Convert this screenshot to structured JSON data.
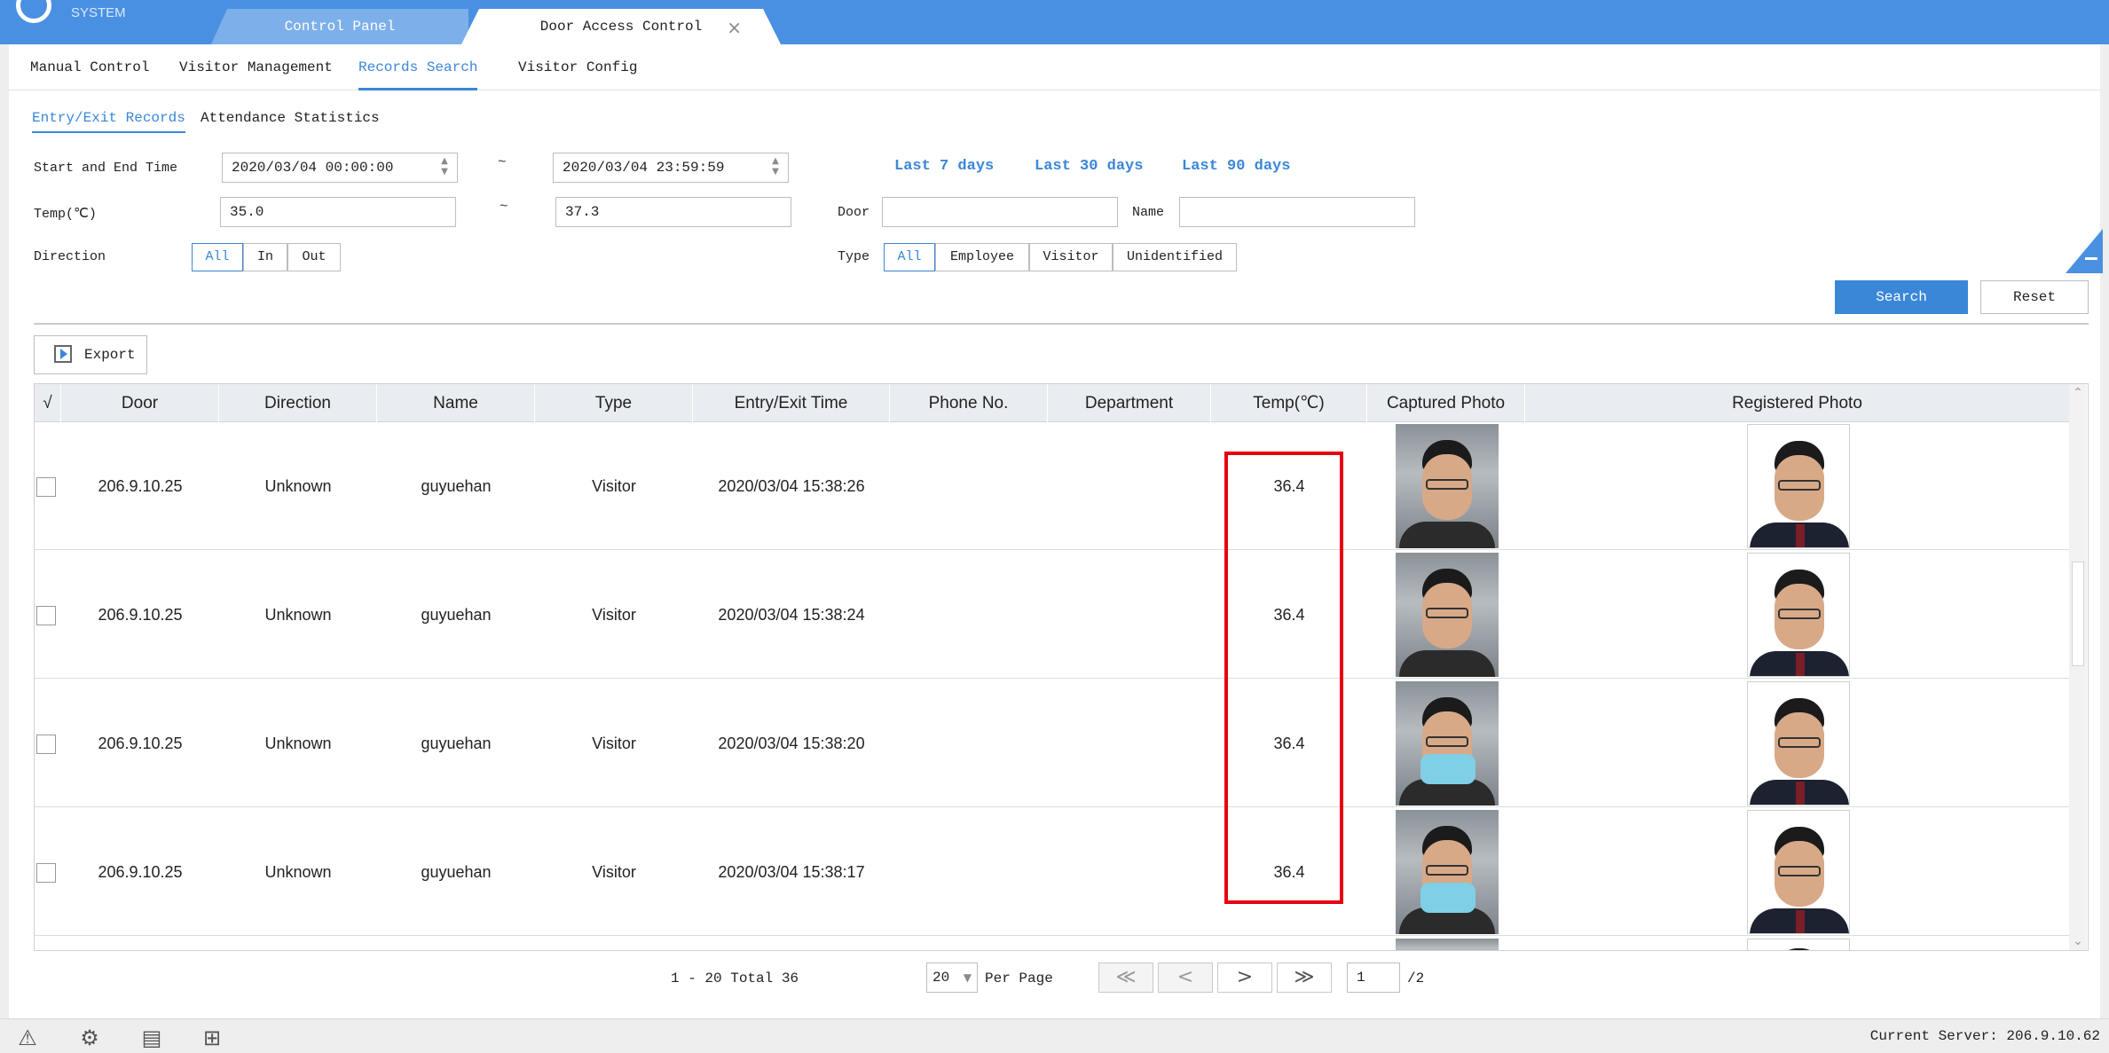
{
  "app": {
    "system_label": "SYSTEM"
  },
  "tabs": [
    {
      "label": "Control Panel",
      "active": false
    },
    {
      "label": "Door Access Control",
      "active": true,
      "close": "×"
    }
  ],
  "subnav": [
    "Manual Control",
    "Visitor Management",
    "Records Search",
    "Visitor Config"
  ],
  "subnav_active": "Records Search",
  "filter_tabs": [
    "Entry/Exit Records",
    "Attendance Statistics"
  ],
  "filters": {
    "time_label": "Start and End Time",
    "start_time": "2020/03/04 00:00:00",
    "end_time": "2020/03/04 23:59:59",
    "tilde": "~",
    "quick": [
      "Last 7 days",
      "Last 30 days",
      "Last 90 days"
    ],
    "temp_label": "Temp(℃)",
    "temp_min": "35.0",
    "temp_max": "37.3",
    "door_label": "Door",
    "door_value": "",
    "name_label": "Name",
    "name_value": "",
    "direction_label": "Direction",
    "direction_options": [
      "All",
      "In",
      "Out"
    ],
    "direction_selected": "All",
    "type_label": "Type",
    "type_options": [
      "All",
      "Employee",
      "Visitor",
      "Unidentified"
    ],
    "type_selected": "All",
    "search": "Search",
    "reset": "Reset"
  },
  "export_label": "Export",
  "table": {
    "check_header": "√",
    "columns": [
      "Door",
      "Direction",
      "Name",
      "Type",
      "Entry/Exit Time",
      "Phone No.",
      "Department",
      "Temp(℃)",
      "Captured Photo",
      "Registered Photo"
    ],
    "rows": [
      {
        "door": "206.9.10.25",
        "direction": "Unknown",
        "name": "guyuehan",
        "type": "Visitor",
        "time": "2020/03/04 15:38:26",
        "phone": "",
        "department": "",
        "temp": "36.4",
        "mask": false
      },
      {
        "door": "206.9.10.25",
        "direction": "Unknown",
        "name": "guyuehan",
        "type": "Visitor",
        "time": "2020/03/04 15:38:24",
        "phone": "",
        "department": "",
        "temp": "36.4",
        "mask": false
      },
      {
        "door": "206.9.10.25",
        "direction": "Unknown",
        "name": "guyuehan",
        "type": "Visitor",
        "time": "2020/03/04 15:38:20",
        "phone": "",
        "department": "",
        "temp": "36.4",
        "mask": true
      },
      {
        "door": "206.9.10.25",
        "direction": "Unknown",
        "name": "guyuehan",
        "type": "Visitor",
        "time": "2020/03/04 15:38:17",
        "phone": "",
        "department": "",
        "temp": "36.4",
        "mask": true
      }
    ]
  },
  "pagination": {
    "summary": "1 - 20 Total 36",
    "per_page_value": "20",
    "per_page_label": "Per Page",
    "first": "≪",
    "prev": "<",
    "next": ">",
    "last": "≫",
    "page": "1",
    "total_pages": "/2"
  },
  "status": {
    "icons": [
      "alarm-icon",
      "sync-settings-icon",
      "export-log-icon",
      "download-icon"
    ],
    "server": "Current Server: 206.9.10.62"
  },
  "colors": {
    "accent": "#4a90e2",
    "link": "#3a87d8",
    "highlight": "#e60012"
  }
}
